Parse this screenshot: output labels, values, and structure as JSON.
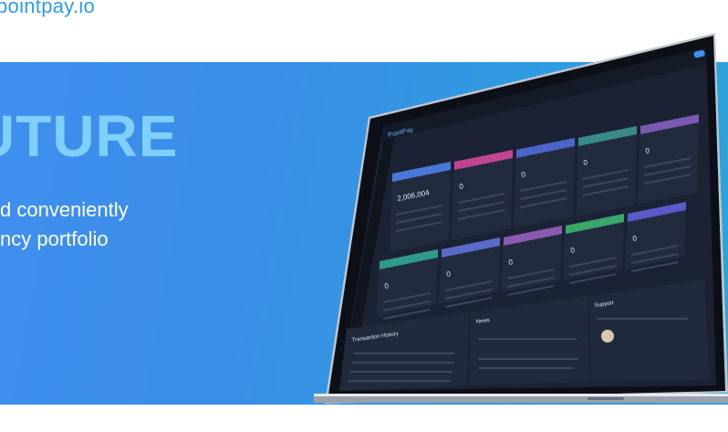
{
  "header": {
    "domain_text": "pointpay.io"
  },
  "hero": {
    "title": "UTURE",
    "line1": "d conveniently",
    "line2": "ncy portfolio"
  },
  "dashboard": {
    "logo": "PointPay",
    "panels": {
      "transactions_title": "Transaction History",
      "news_title": "News",
      "support_title": "Support"
    },
    "cards_row1": [
      {
        "value": "2,006,004",
        "accent": "#4a78d8"
      },
      {
        "value": "0",
        "accent": "#c0468f"
      },
      {
        "value": "0",
        "accent": "#4a66c8"
      },
      {
        "value": "0",
        "accent": "#3a8a8a"
      },
      {
        "value": "0",
        "accent": "#7a5ab0"
      }
    ],
    "cards_row2": [
      {
        "value": "0",
        "accent": "#2e9a8a"
      },
      {
        "value": "0",
        "accent": "#5a6ac8"
      },
      {
        "value": "0",
        "accent": "#8a5ab0"
      },
      {
        "value": "0",
        "accent": "#3aa66a"
      },
      {
        "value": "0",
        "accent": "#5a5ac8"
      }
    ]
  },
  "colors": {
    "hero_gradient_start": "#3f8ff0",
    "hero_gradient_end": "#2ea3d9",
    "domain_text": "#2f9bf0",
    "hero_title": "#7fd0ff",
    "screen_bg": "#1a2233"
  }
}
